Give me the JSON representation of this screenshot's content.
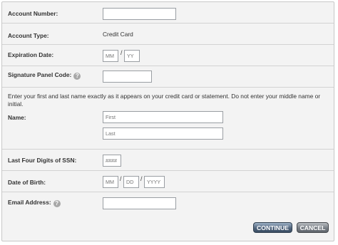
{
  "form": {
    "account_number": {
      "label": "Account Number:",
      "value": ""
    },
    "account_type": {
      "label": "Account Type:",
      "value": "Credit Card"
    },
    "expiration": {
      "label": "Expiration Date:",
      "month_placeholder": "MM",
      "year_placeholder": "YY",
      "separator": "/"
    },
    "signature_code": {
      "label": "Signature Panel Code:",
      "help": "?",
      "value": ""
    },
    "name_instructions": "Enter your first and last name exactly as it appears on your credit card or statement. Do not enter your middle name or initial.",
    "name": {
      "label": "Name:",
      "first_placeholder": "First",
      "last_placeholder": "Last"
    },
    "ssn": {
      "label": "Last Four Digits of SSN:",
      "placeholder": "####"
    },
    "dob": {
      "label": "Date of Birth:",
      "month_placeholder": "MM",
      "day_placeholder": "DD",
      "year_placeholder": "YYYY",
      "separator": "/"
    },
    "email": {
      "label": "Email Address:",
      "help": "?",
      "value": ""
    }
  },
  "buttons": {
    "continue": "CONTINUE",
    "cancel": "CANCEL"
  }
}
